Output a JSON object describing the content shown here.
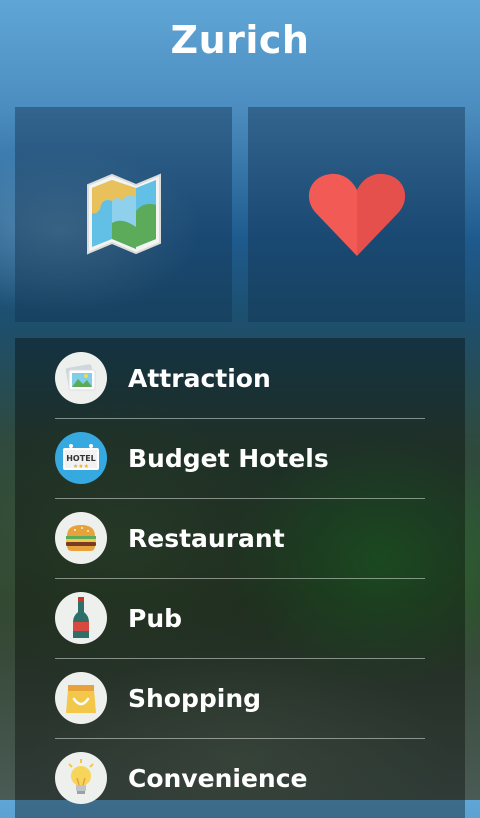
{
  "header": {
    "title": "Zurich"
  },
  "tiles": [
    {
      "name": "map",
      "icon": "map-icon"
    },
    {
      "name": "favorites",
      "icon": "heart-icon"
    }
  ],
  "categories": [
    {
      "label": "Attraction",
      "icon": "photo-icon"
    },
    {
      "label": "Budget Hotels",
      "icon": "hotel-sign-icon"
    },
    {
      "label": "Restaurant",
      "icon": "burger-icon"
    },
    {
      "label": "Pub",
      "icon": "wine-bottle-icon"
    },
    {
      "label": "Shopping",
      "icon": "shopping-bag-icon"
    },
    {
      "label": "Convenience",
      "icon": "lightbulb-icon"
    }
  ],
  "hotel_sign_text": "HOTEL",
  "colors": {
    "heart": "#f25a55",
    "hotel_circle": "#35a9e0",
    "map_blue": "#62c0e6",
    "map_green": "#5bab5a"
  }
}
